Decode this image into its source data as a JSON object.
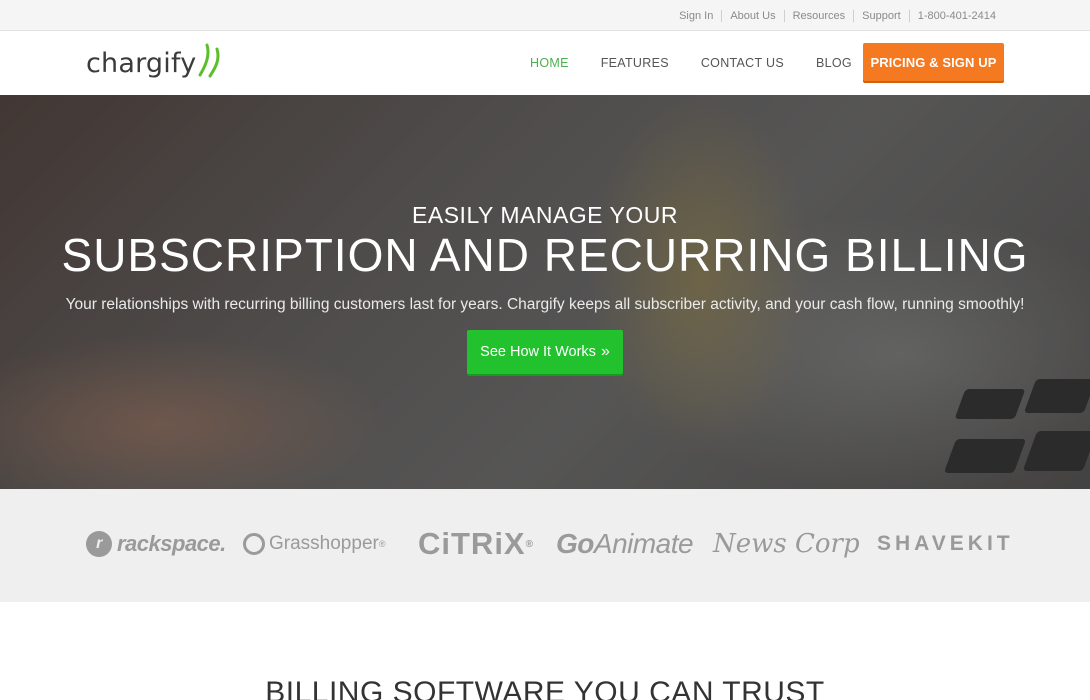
{
  "utility_bar": {
    "links": [
      "Sign In",
      "About Us",
      "Resources",
      "Support",
      "1-800-401-2414"
    ]
  },
  "header": {
    "logo_text": "chargify",
    "nav": [
      "HOME",
      "FEATURES",
      "CONTACT US",
      "BLOG"
    ],
    "active_nav": "HOME",
    "cta_label": "PRICING & SIGN UP"
  },
  "hero": {
    "eyebrow": "EASILY MANAGE YOUR",
    "title": "SUBSCRIPTION AND RECURRING BILLING",
    "subtitle": "Your relationships with recurring billing customers last for years. Chargify keeps all subscriber activity, and your cash flow, running smoothly!",
    "cta_label": "See How It Works",
    "cta_icon": "double-chevron-right-icon"
  },
  "clients": {
    "rackspace": "rackspace.",
    "grasshopper": "Grasshopper",
    "grasshopper_mark": "®",
    "citrix": "CiTRiX",
    "citrix_mark": "®",
    "goanimate_go": "Go",
    "goanimate_rest": "Animate",
    "newscorp": "News Corp",
    "shavekit": "SHAVEKIT"
  },
  "section": {
    "heading": "BILLING SOFTWARE YOU CAN TRUST"
  },
  "colors": {
    "accent_green": "#4caf50",
    "pricing_orange": "#f47920",
    "cta_green": "#22c22e"
  }
}
